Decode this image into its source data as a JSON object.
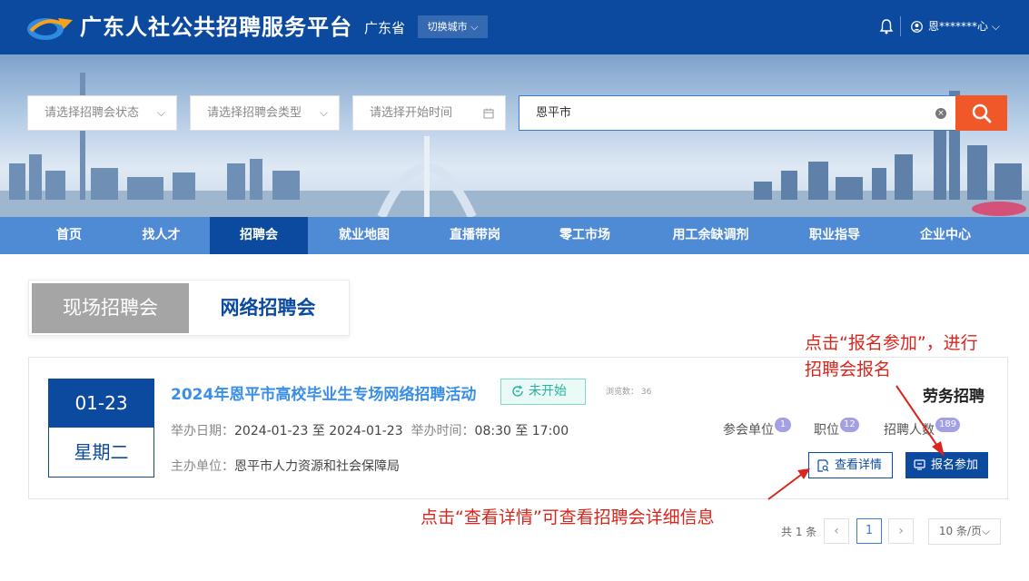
{
  "header": {
    "site_title": "广东人社公共招聘服务平台",
    "province": "广东省",
    "switch_city": "切换城市",
    "user_name": "恩*******心"
  },
  "search": {
    "status_placeholder": "请选择招聘会状态",
    "type_placeholder": "请选择招聘会类型",
    "date_placeholder": "请选择开始时间",
    "keyword_value": "恩平市"
  },
  "nav": {
    "items": [
      "首页",
      "找人才",
      "招聘会",
      "就业地图",
      "直播带岗",
      "零工市场",
      "用工余缺调剂",
      "职业指导",
      "企业中心"
    ],
    "active": "招聘会"
  },
  "tabs": {
    "offline": "现场招聘会",
    "online": "网络招聘会"
  },
  "fair": {
    "date": "01-23",
    "weekday": "星期二",
    "title": "2024年恩平市高校毕业生专场网络招聘活动",
    "status": "未开始",
    "views": "浏览数： 36",
    "date_label": "举办日期：",
    "date_range": "2024-01-23 至 2024-01-23",
    "time_label": "举办时间：",
    "time_range": "08:30 至 17:00",
    "organizer_label": "主办单位：",
    "organizer": "恩平市人力资源和社会保障局",
    "category": "劳务招聘",
    "units_label": "参会单位",
    "units_count": "1",
    "positions_label": "职位",
    "positions_count": "12",
    "hires_label": "招聘人数",
    "hires_count": "189",
    "detail_button": "查看详情",
    "join_button": "报名参加"
  },
  "annotations": {
    "join_line1": "点击“报名参加”，进行",
    "join_line2": "招聘会报名",
    "detail": "点击“查看详情”可查看招聘会详细信息"
  },
  "pagination": {
    "total": "共 1 条",
    "prev": "‹",
    "current": "1",
    "next": "›",
    "page_size": "10 条/页"
  },
  "colors": {
    "primary": "#0b4a9e",
    "nav": "#4f8ad5",
    "accent_orange": "#f0582a",
    "annotation_red": "#d9261c",
    "title_blue": "#3a8ee6",
    "status_green": "#27b39f"
  }
}
